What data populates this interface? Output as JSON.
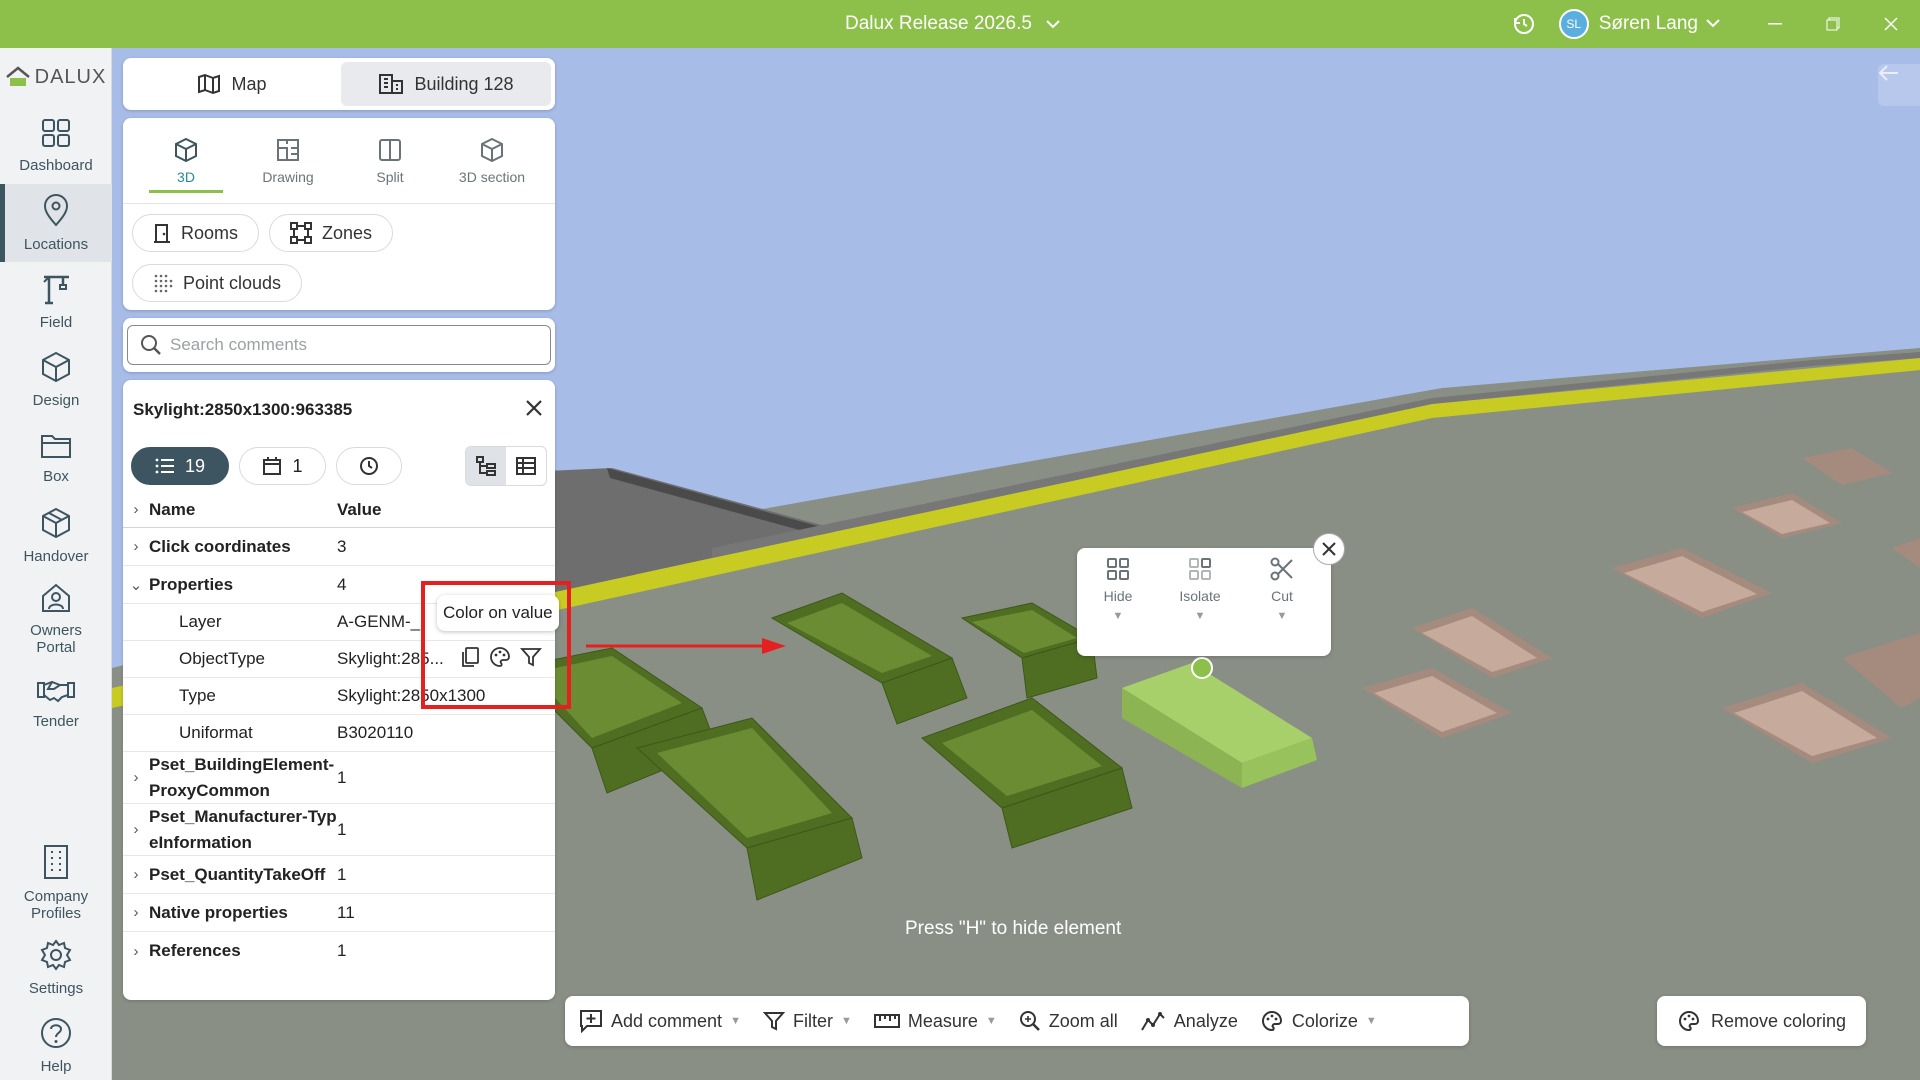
{
  "titlebar": {
    "title": "Dalux Release 2026.5",
    "user_initials": "SL",
    "user_name": "Søren Lang"
  },
  "rail": {
    "logo": "DALUX",
    "items": [
      {
        "label": "Dashboard",
        "icon": "grid-icon"
      },
      {
        "label": "Locations",
        "icon": "location-pin-icon",
        "active": true
      },
      {
        "label": "Field",
        "icon": "crane-icon"
      },
      {
        "label": "Design",
        "icon": "cube-icon"
      },
      {
        "label": "Box",
        "icon": "folder-icon"
      },
      {
        "label": "Handover",
        "icon": "box-icon"
      },
      {
        "label": "Owners Portal",
        "icon": "house-person-icon"
      },
      {
        "label": "Tender",
        "icon": "handshake-icon"
      }
    ],
    "bottom_items": [
      {
        "label": "Company Profiles",
        "icon": "building-icon"
      },
      {
        "label": "Settings",
        "icon": "gear-icon"
      },
      {
        "label": "Help",
        "icon": "help-icon"
      }
    ]
  },
  "top_segment": {
    "map_label": "Map",
    "building_label": "Building 128"
  },
  "views": {
    "tabs": [
      "3D",
      "Drawing",
      "Split",
      "3D section"
    ],
    "selected": "3D",
    "chips": [
      "Rooms",
      "Zones",
      "Point clouds"
    ]
  },
  "search": {
    "placeholder": "Search comments"
  },
  "properties": {
    "title": "Skylight:2850x1300:963385",
    "count_properties": "19",
    "count_calendar": "1",
    "header_name": "Name",
    "header_value": "Value",
    "rows": [
      {
        "name": "Click coordinates",
        "value": "3"
      },
      {
        "name": "Properties",
        "value": "4"
      },
      {
        "name": "Layer",
        "value": "A-GENM-_"
      },
      {
        "name": "ObjectType",
        "value": "Skylight:285..."
      },
      {
        "name": "Type",
        "value": "Skylight:2850x1300"
      },
      {
        "name": "Uniformat",
        "value": "B3020110"
      },
      {
        "name": "Pset_BuildingElement-ProxyCommon",
        "value": "1"
      },
      {
        "name": "Pset_Manufacturer-TypeInformation",
        "value": "1"
      },
      {
        "name": "Pset_QuantityTakeOff",
        "value": "1"
      },
      {
        "name": "Native properties",
        "value": "11"
      },
      {
        "name": "References",
        "value": "1"
      }
    ],
    "tooltip": "Color on value"
  },
  "context_menu": {
    "items": [
      "Hide",
      "Isolate",
      "Cut"
    ]
  },
  "hint": "Press \"H\" to hide element",
  "toolbar": {
    "add_comment": "Add comment",
    "filter": "Filter",
    "measure": "Measure",
    "zoom_all": "Zoom all",
    "analyze": "Analyze",
    "colorize": "Colorize",
    "remove_coloring": "Remove coloring"
  },
  "colors": {
    "brand": "#8cc04a",
    "sky": "#a8bce8",
    "roof": "#8a8f86",
    "skylight_green": "#5e7d2e",
    "skylight_selected": "#a8d06a",
    "skylight_brown": "#b89a8e",
    "highlight_red": "#e52020"
  }
}
